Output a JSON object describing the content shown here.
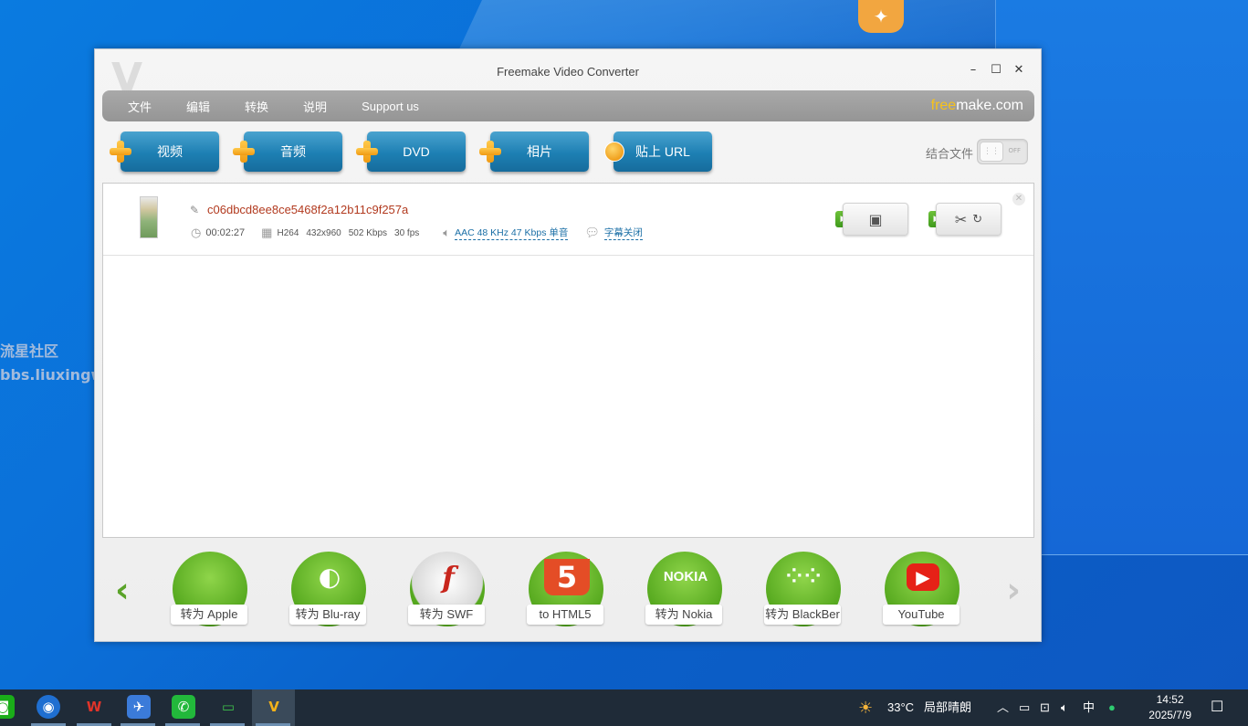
{
  "window": {
    "title": "Freemake Video Converter",
    "brand_free": "free",
    "brand_rest": "make.com"
  },
  "menu": [
    "文件",
    "编辑",
    "转换",
    "说明",
    "Support us"
  ],
  "toolbar": {
    "buttons": [
      "视频",
      "音频",
      "DVD",
      "相片",
      "贴上 URL"
    ],
    "join_label": "结合文件",
    "toggle_state": "OFF"
  },
  "file": {
    "name": "c06dbcd8ee8ce5468f2a12b11c9f257a",
    "duration": "00:02:27",
    "codec": "H264",
    "resolution": "432x960",
    "bitrate": "502 Kbps",
    "fps": "30 fps",
    "audio": "AAC  48 KHz  47 Kbps  单音",
    "subtitles": "字幕关闭"
  },
  "formats": [
    {
      "label": "转为 Apple",
      "icon": "apple-icon"
    },
    {
      "label": "转为 Blu-ray",
      "icon": "bluray-icon"
    },
    {
      "label": "转为 SWF",
      "icon": "flash-icon"
    },
    {
      "label": "to HTML5",
      "icon": "html5-icon"
    },
    {
      "label": "转为 Nokia",
      "icon": "nokia-icon"
    },
    {
      "label": "转为 BlackBer",
      "icon": "blackberry-icon"
    },
    {
      "label": "YouTube",
      "icon": "youtube-icon"
    }
  ],
  "format_glyphs": {
    "nokia": "NOKIA",
    "html5": "5"
  },
  "watermark": {
    "line1": "流星社区",
    "line2": "bbs.liuxingw.com"
  },
  "taskbar": {
    "weather_temp": "33°C",
    "weather_desc": "局部晴朗",
    "ime": "中",
    "time": "14:52",
    "date": "2025/7/9"
  },
  "colors": {
    "accent_blue": "#1d7fb3",
    "accent_green": "#55a81e",
    "file_name_red": "#b23a1f",
    "brand_yellow": "#f7c21a"
  }
}
